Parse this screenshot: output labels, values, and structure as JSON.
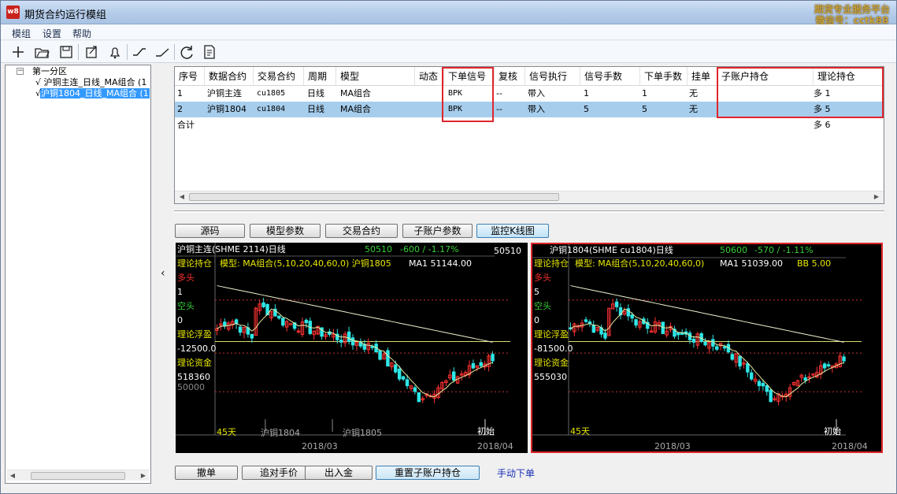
{
  "window": {
    "title": "期货合约运行模组",
    "app_icon": "w8",
    "watermark_line1": "期货专业服务平台",
    "watermark_line2": "微信号：cctk88"
  },
  "menu": [
    "模组",
    "设置",
    "帮助"
  ],
  "toolbar_icons": [
    "new-icon",
    "open-folder-icon",
    "save-icon",
    "export-icon",
    "bell-icon",
    "line-up-icon",
    "line-slope-icon",
    "refresh-icon",
    "report-icon"
  ],
  "tree": {
    "group_label": "第一分区",
    "items": [
      {
        "check": "√",
        "label": "沪铜主连_日线_MA组合 (1",
        "selected": false
      },
      {
        "check": "√",
        "label": "沪铜1804_日线_MA组合 (1",
        "selected": true
      }
    ]
  },
  "grid": {
    "headers": [
      "序号",
      "数据合约",
      "交易合约",
      "周期",
      "模型",
      "动态",
      "下单信号",
      "复核",
      "信号执行",
      "信号手数",
      "下单手数",
      "挂单",
      "子账户持仓",
      "理论持仓"
    ],
    "rows": [
      [
        "1",
        "沪铜主连",
        "cu1805",
        "日线",
        "MA组合",
        "",
        "BPK",
        "--",
        "带入",
        "1",
        "1",
        "无",
        "",
        "多 1"
      ],
      [
        "2",
        "沪铜1804",
        "cu1804",
        "日线",
        "MA组合",
        "",
        "BPK",
        "--",
        "带入",
        "5",
        "5",
        "无",
        "",
        "多 5"
      ]
    ],
    "total_label": "合计",
    "total_position": "多 6"
  },
  "tabs": [
    {
      "label": "源码",
      "active": false
    },
    {
      "label": "模型参数",
      "active": false
    },
    {
      "label": "交易合约",
      "active": false
    },
    {
      "label": "子账户参数",
      "active": false
    },
    {
      "label": "监控K线图",
      "active": true
    }
  ],
  "charts": [
    {
      "title": "沪铜主连(SHME 2114)日线",
      "price": "50510",
      "change": "-600 / -1.17%",
      "price_right": "50510",
      "model_line": "模型: MA组合(5,10,20,40,60,0) 沪铜1805",
      "ma_line": "MA1 51144.00",
      "bb_line": "",
      "side": {
        "theory_label": "理论持仓",
        "long_label": "多头",
        "long_value": "1",
        "short_label": "空头",
        "short_value": "0",
        "pnl_label": "理论浮盈",
        "pnl_value": "-12500.0",
        "fund_label": "理论资金",
        "fund_value": "518360"
      },
      "axis_label": "50000",
      "days": "45天",
      "contract_marks": [
        "沪铜1804",
        "沪铜1805"
      ],
      "start_label": "初始",
      "date_left": "2018/03",
      "date_right": "2018/04",
      "highlighted": false
    },
    {
      "title": "沪铜1804(SHME cu1804)日线",
      "price": "50600",
      "change": "-570 / -1.11%",
      "price_right": "",
      "model_line": "模型: MA组合(5,10,20,40,60,0)",
      "ma_line": "MA1 51039.00",
      "bb_line": "BB 5.00",
      "side": {
        "theory_label": "理论持仓",
        "long_label": "多头",
        "long_value": "5",
        "short_label": "空头",
        "short_value": "0",
        "pnl_label": "理论浮盈",
        "pnl_value": "-81500.0",
        "fund_label": "理论资金",
        "fund_value": "555030"
      },
      "axis_label": "",
      "days": "45天",
      "contract_marks": [],
      "start_label": "初始",
      "date_left": "2018/03",
      "date_right": "2018/04",
      "highlighted": true
    }
  ],
  "buttons": [
    "撤单",
    "追对手价",
    "出入金",
    "重置子账户持仓"
  ],
  "manual_order_label": "手动下单",
  "colors": {
    "up": "#ff3232",
    "down": "#2ee6e6",
    "ma": "#e8e8a0",
    "highlight_border": "#e0262b",
    "label_yellow": "#e6e600",
    "label_red": "#ff3030",
    "label_green": "#38d038"
  }
}
